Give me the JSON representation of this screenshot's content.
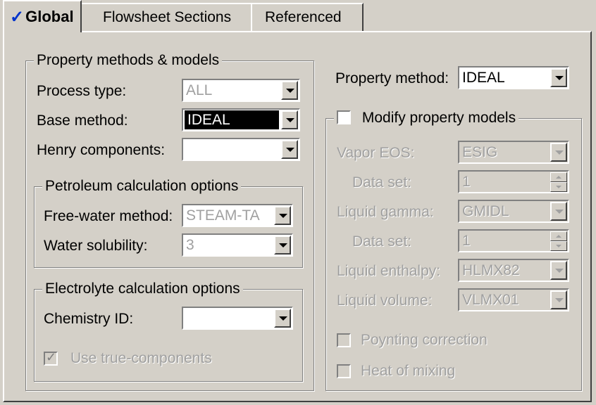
{
  "tabs": [
    {
      "label": "Global",
      "checked": true
    },
    {
      "label": "Flowsheet Sections"
    },
    {
      "label": "Referenced"
    }
  ],
  "property_methods": {
    "legend": "Property methods & models",
    "process_type": {
      "label": "Process type:",
      "value": "ALL"
    },
    "base_method": {
      "label": "Base method:",
      "value": "IDEAL"
    },
    "henry_components": {
      "label": "Henry components:",
      "value": ""
    },
    "petroleum": {
      "legend": "Petroleum calculation options",
      "free_water_method": {
        "label": "Free-water method:",
        "value": "STEAM-TA"
      },
      "water_solubility": {
        "label": "Water solubility:",
        "value": "3"
      }
    },
    "electrolyte": {
      "legend": "Electrolyte calculation options",
      "chemistry_id": {
        "label": "Chemistry ID:",
        "value": ""
      },
      "use_true_components": {
        "label": "Use true-components",
        "checked": true,
        "enabled": false
      }
    }
  },
  "property_method": {
    "label": "Property method:",
    "value": "IDEAL"
  },
  "modify_models": {
    "label": "Modify property models",
    "checked": false,
    "vapor_eos": {
      "label": "Vapor EOS:",
      "value": "ESIG"
    },
    "vapor_data_set": {
      "label": "Data set:",
      "value": "1"
    },
    "liquid_gamma": {
      "label": "Liquid gamma:",
      "value": "GMIDL"
    },
    "gamma_data_set": {
      "label": "Data set:",
      "value": "1"
    },
    "liquid_enthalpy": {
      "label": "Liquid enthalpy:",
      "value": "HLMX82"
    },
    "liquid_volume": {
      "label": "Liquid volume:",
      "value": "VLMX01"
    },
    "poynting": {
      "label": "Poynting correction",
      "checked": false
    },
    "heat_of_mixing": {
      "label": "Heat of mixing",
      "checked": false
    }
  },
  "colors": {
    "face": "#d4d0c8",
    "check_accent": "#0033cc"
  }
}
